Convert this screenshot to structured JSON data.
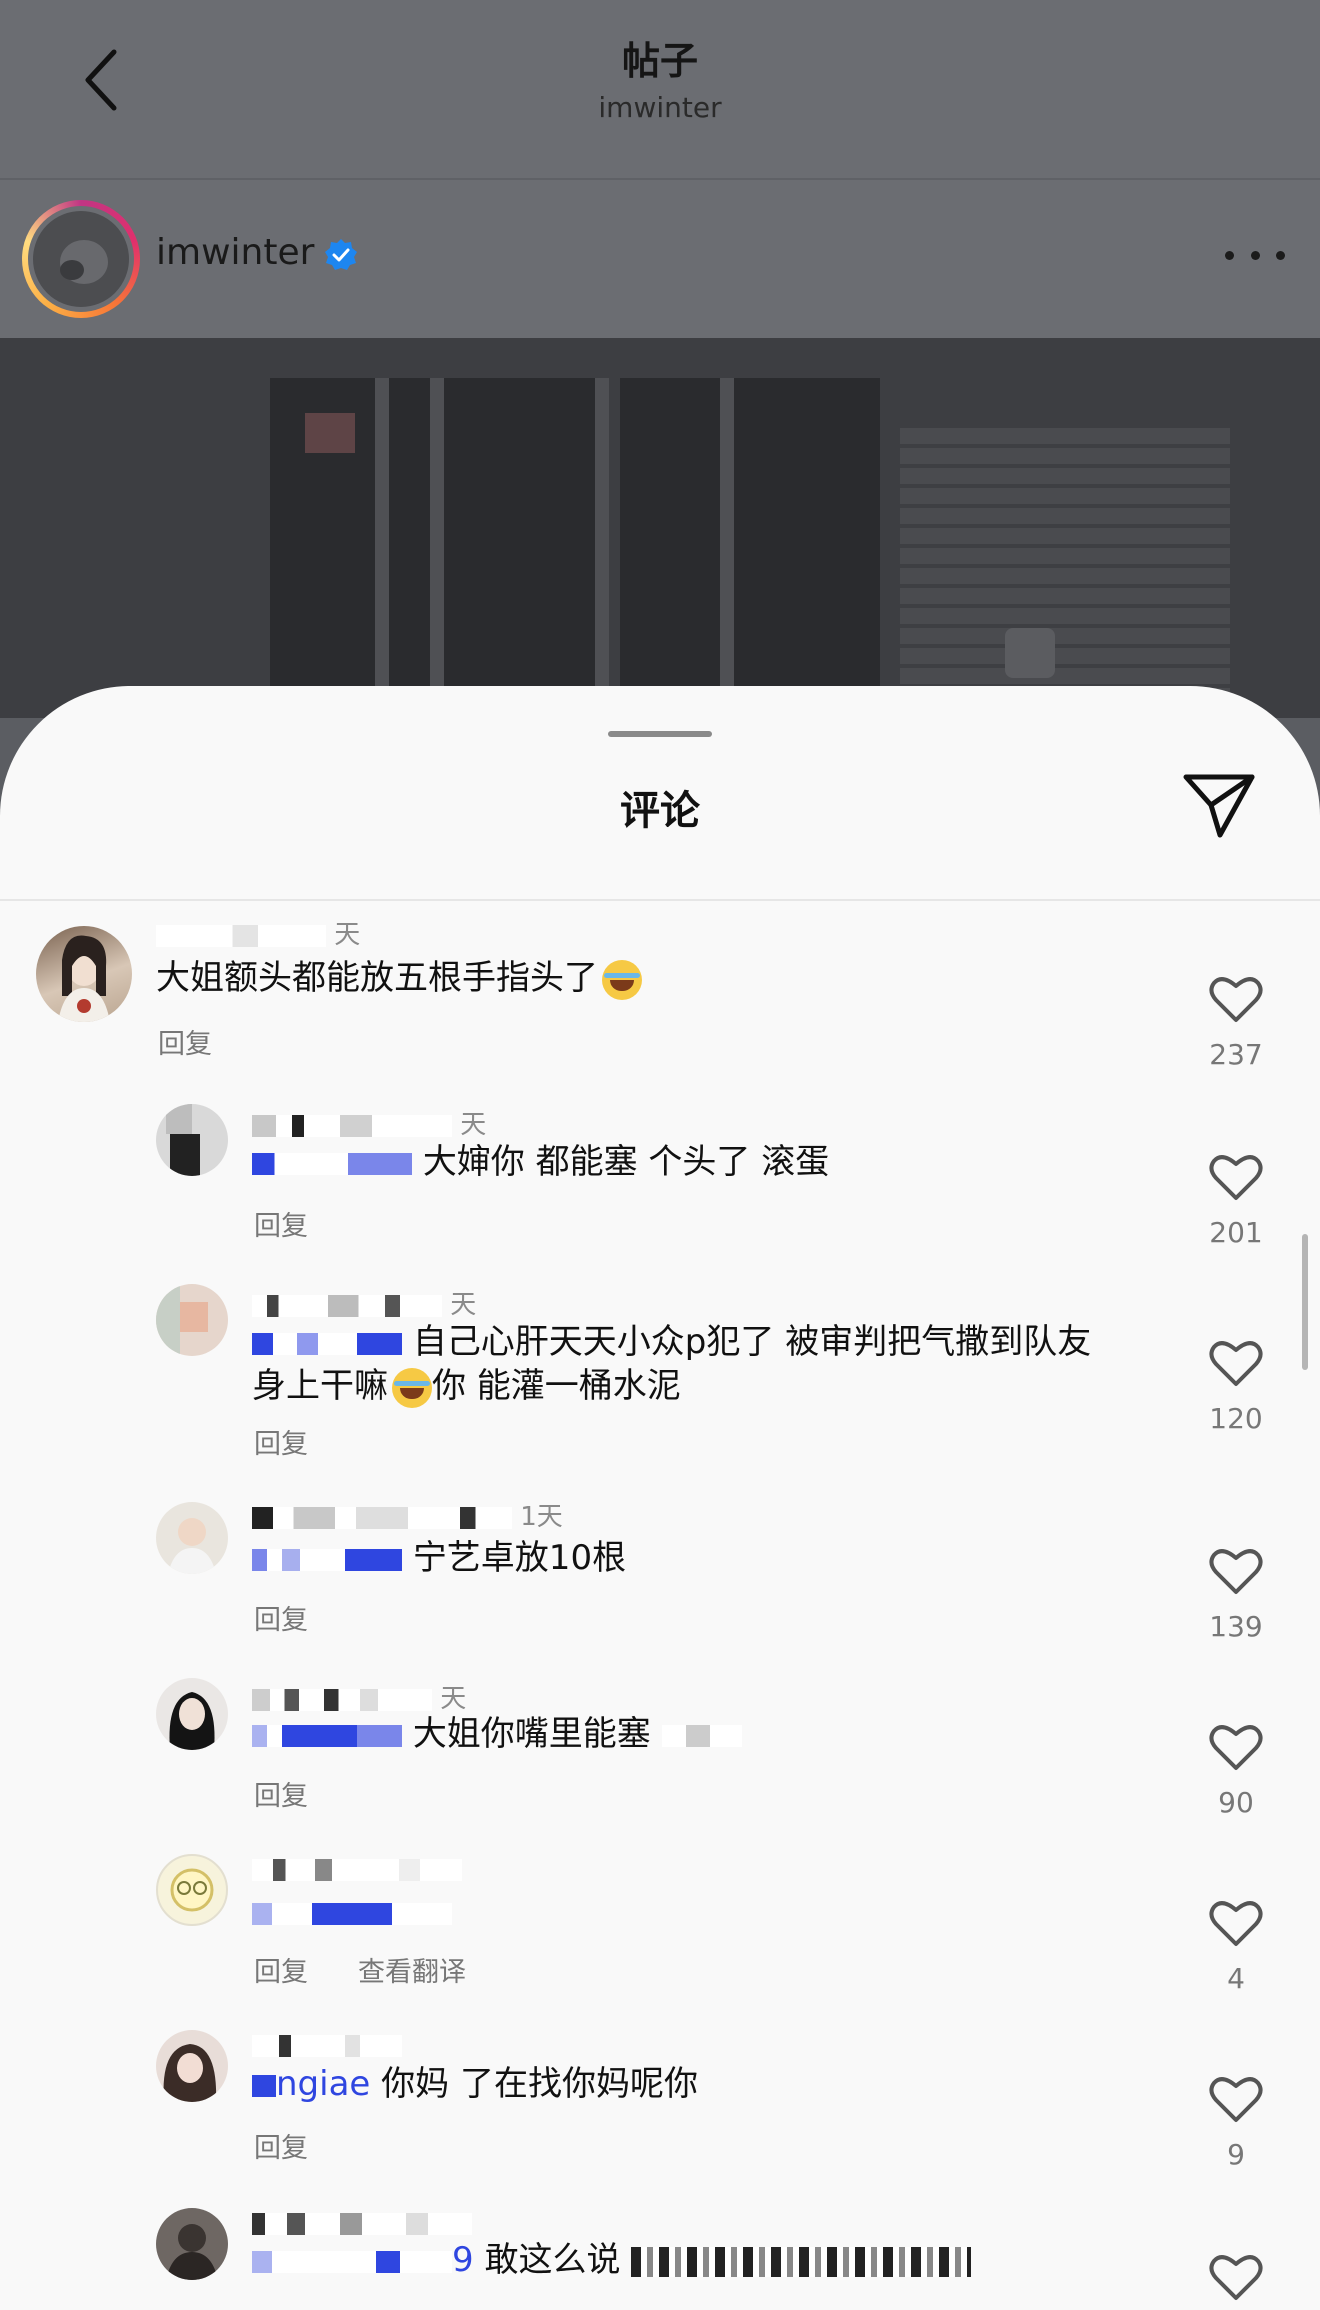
{
  "header": {
    "title": "帖子",
    "subtitle": "imwinter"
  },
  "author": {
    "username": "imwinter",
    "verified": true
  },
  "sheet": {
    "title": "评论"
  },
  "icons": {
    "back": "chevron-left-icon",
    "verified": "verified-badge-icon",
    "more": "more-horizontal-icon",
    "share": "paper-plane-icon",
    "like": "heart-outline-icon"
  },
  "colors": {
    "mention": "#2f46e0",
    "verified": "#1d86f0"
  },
  "comments": [
    {
      "meta": "天",
      "text": "大姐额头都能放五根手指头了",
      "mention": "",
      "reply": "回复",
      "translate": "",
      "likes": "237",
      "emoji": true
    },
    {
      "meta": "天",
      "text": "大婶你 都能塞 个头了 滚蛋",
      "mention": "",
      "reply": "回复",
      "translate": "",
      "likes": "201",
      "emoji": false
    },
    {
      "meta": "天",
      "text": "自己心肝天天小众p犯了 被审判把气撒到队友",
      "text2": "身上干嘛",
      "text3": "你 能灌一桶水泥",
      "mention": "",
      "reply": "回复",
      "translate": "",
      "likes": "120",
      "emoji": true
    },
    {
      "meta": "1天",
      "text": "宁艺卓放10根",
      "mention": "",
      "reply": "回复",
      "translate": "",
      "likes": "139",
      "emoji": false
    },
    {
      "meta": "天",
      "text": "大姐你嘴里能塞",
      "mention": "",
      "reply": "回复",
      "translate": "",
      "likes": "90",
      "emoji": false
    },
    {
      "meta": "",
      "text": "",
      "mention": "",
      "reply": "回复",
      "translate": "查看翻译",
      "likes": "4",
      "emoji": false
    },
    {
      "meta": "",
      "text": "你妈 了在找你妈呢你",
      "mention": "ngiae",
      "reply": "回复",
      "translate": "",
      "likes": "9",
      "emoji": false
    },
    {
      "meta": "",
      "text": "敢这么说",
      "mention": "9",
      "reply": "",
      "translate": "",
      "likes": "",
      "emoji": false
    }
  ]
}
